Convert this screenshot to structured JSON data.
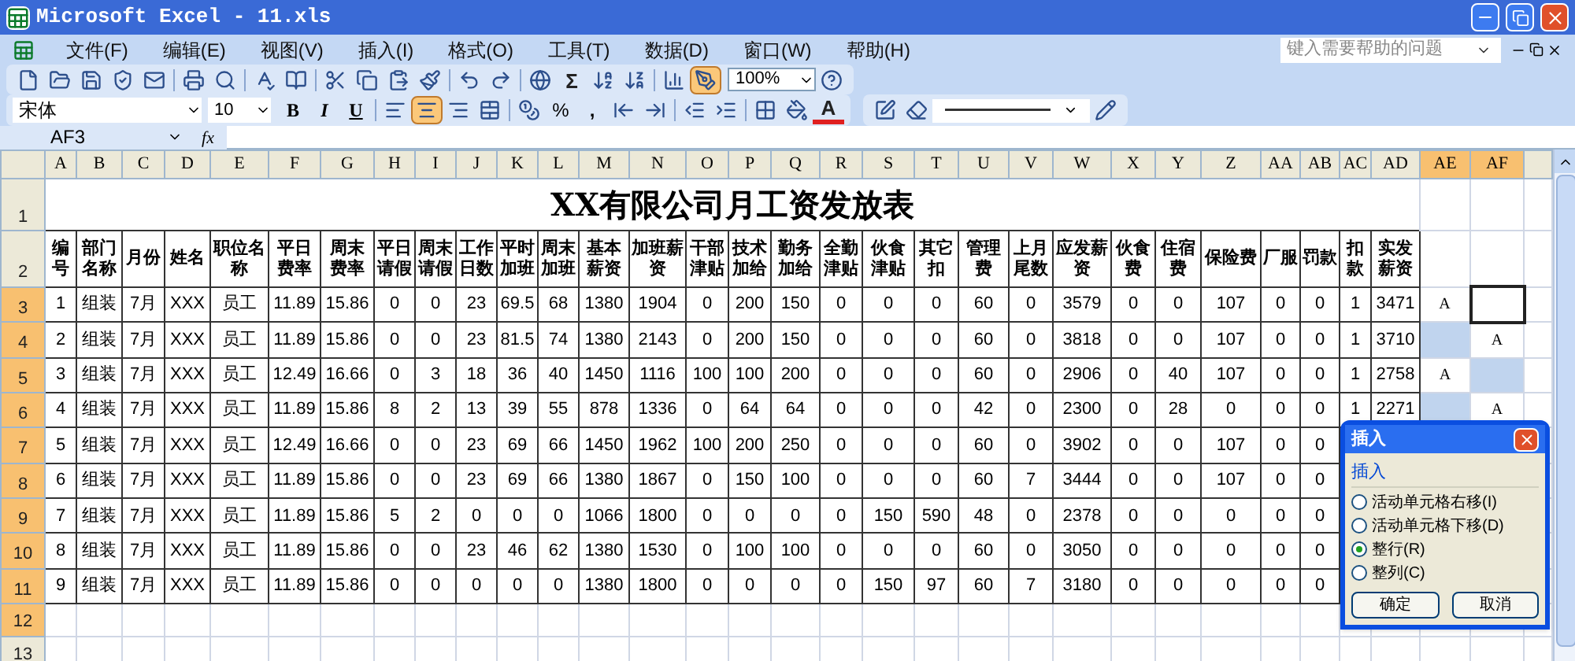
{
  "window": {
    "title": "Microsoft Excel - 11.xls"
  },
  "menu": [
    "文件(F)",
    "编辑(E)",
    "视图(V)",
    "插入(I)",
    "格式(O)",
    "工具(T)",
    "数据(D)",
    "窗口(W)",
    "帮助(H)"
  ],
  "help_box": {
    "placeholder": "键入需要帮助的问题"
  },
  "toolbar": {
    "sum_glyph": "Σ",
    "zoom": "100%",
    "drawing_toggle": {
      "selected": true
    }
  },
  "format_toolbar": {
    "font": "宋体",
    "size": "10",
    "style_buttons": [
      "B",
      "I",
      "U"
    ],
    "align_buttons": [
      {
        "selected": false
      },
      {
        "selected": true
      },
      {
        "selected": false
      }
    ],
    "percent": "%",
    "comma": ",",
    "font_color_glyph": "A"
  },
  "formula_bar": {
    "name_box": "AF3",
    "fx": "fx"
  },
  "sheet": {
    "columns": [
      {
        "label": "A",
        "selected": false
      },
      {
        "label": "B",
        "selected": false
      },
      {
        "label": "C",
        "selected": false
      },
      {
        "label": "D",
        "selected": false
      },
      {
        "label": "E",
        "selected": false
      },
      {
        "label": "F",
        "selected": false
      },
      {
        "label": "G",
        "selected": false
      },
      {
        "label": "H",
        "selected": false
      },
      {
        "label": "I",
        "selected": false
      },
      {
        "label": "J",
        "selected": false
      },
      {
        "label": "K",
        "selected": false
      },
      {
        "label": "L",
        "selected": false
      },
      {
        "label": "M",
        "selected": false
      },
      {
        "label": "N",
        "selected": false
      },
      {
        "label": "O",
        "selected": false
      },
      {
        "label": "P",
        "selected": false
      },
      {
        "label": "Q",
        "selected": false
      },
      {
        "label": "R",
        "selected": false
      },
      {
        "label": "S",
        "selected": false
      },
      {
        "label": "T",
        "selected": false
      },
      {
        "label": "U",
        "selected": false
      },
      {
        "label": "V",
        "selected": false
      },
      {
        "label": "W",
        "selected": false
      },
      {
        "label": "X",
        "selected": false
      },
      {
        "label": "Y",
        "selected": false
      },
      {
        "label": "Z",
        "selected": false
      },
      {
        "label": "AA",
        "selected": false
      },
      {
        "label": "AB",
        "selected": false
      },
      {
        "label": "AC",
        "selected": false
      },
      {
        "label": "AD",
        "selected": false
      },
      {
        "label": "AE",
        "selected": true
      },
      {
        "label": "AF",
        "selected": true
      }
    ],
    "title_row": {
      "row_number": "1",
      "selected": false,
      "title": "XX有限公司月工资发放表"
    },
    "header_row": {
      "row_number": "2",
      "selected": false,
      "headers": [
        "编号",
        "部门名称",
        "月份",
        "姓名",
        "职位名称",
        "平日费率",
        "周末费率",
        "平日请假",
        "周末请假",
        "工作日数",
        "平时加班",
        "周末加班",
        "基本薪资",
        "加班薪资",
        "干部津贴",
        "技术加给",
        "勤务加给",
        "全勤津贴",
        "伙食津贴",
        "其它扣",
        "管理费",
        "上月尾数",
        "应发薪资",
        "伙食费",
        "住宿费",
        "保险费",
        "厂服",
        "罚款",
        "扣款",
        "实发薪资"
      ]
    },
    "rows": [
      {
        "row_number": "3",
        "selected": true,
        "cells": [
          "1",
          "组装",
          "7月",
          "XXX",
          "员工",
          "11.89",
          "15.86",
          "0",
          "0",
          "23",
          "69.5",
          "68",
          "1380",
          "1904",
          "0",
          "200",
          "150",
          "0",
          "0",
          "0",
          "60",
          "0",
          "3579",
          "0",
          "0",
          "107",
          "0",
          "0",
          "1",
          "3471"
        ],
        "extra": [
          {
            "text": "A",
            "selected": false,
            "active": false
          },
          {
            "selected": false,
            "active": true
          }
        ]
      },
      {
        "row_number": "4",
        "selected": true,
        "cells": [
          "2",
          "组装",
          "7月",
          "XXX",
          "员工",
          "11.89",
          "15.86",
          "0",
          "0",
          "23",
          "81.5",
          "74",
          "1380",
          "2143",
          "0",
          "200",
          "150",
          "0",
          "0",
          "0",
          "60",
          "0",
          "3818",
          "0",
          "0",
          "107",
          "0",
          "0",
          "1",
          "3710"
        ],
        "extra": [
          {
            "selected": true,
            "active": false
          },
          {
            "text": "A",
            "selected": false,
            "active": false
          }
        ]
      },
      {
        "row_number": "5",
        "selected": true,
        "cells": [
          "3",
          "组装",
          "7月",
          "XXX",
          "员工",
          "12.49",
          "16.66",
          "0",
          "3",
          "18",
          "36",
          "40",
          "1450",
          "1116",
          "100",
          "100",
          "200",
          "0",
          "0",
          "0",
          "60",
          "0",
          "2906",
          "0",
          "40",
          "107",
          "0",
          "0",
          "1",
          "2758"
        ],
        "extra": [
          {
            "text": "A",
            "selected": false,
            "active": false
          },
          {
            "selected": true,
            "active": false
          }
        ]
      },
      {
        "row_number": "6",
        "selected": true,
        "cells": [
          "4",
          "组装",
          "7月",
          "XXX",
          "员工",
          "11.89",
          "15.86",
          "8",
          "2",
          "13",
          "39",
          "55",
          "878",
          "1336",
          "0",
          "64",
          "64",
          "0",
          "0",
          "0",
          "42",
          "0",
          "2300",
          "0",
          "28",
          "0",
          "0",
          "0",
          "1",
          "2271"
        ],
        "extra": [
          {
            "selected": true,
            "active": false
          },
          {
            "text": "A",
            "selected": false,
            "active": false
          }
        ]
      },
      {
        "row_number": "7",
        "selected": true,
        "cells": [
          "5",
          "组装",
          "7月",
          "XXX",
          "员工",
          "12.49",
          "16.66",
          "0",
          "0",
          "23",
          "69",
          "66",
          "1450",
          "1962",
          "100",
          "200",
          "250",
          "0",
          "0",
          "0",
          "60",
          "0",
          "3902",
          "0",
          "0",
          "107",
          "0",
          "0"
        ]
      },
      {
        "row_number": "8",
        "selected": true,
        "cells": [
          "6",
          "组装",
          "7月",
          "XXX",
          "员工",
          "11.89",
          "15.86",
          "0",
          "0",
          "23",
          "69",
          "66",
          "1380",
          "1867",
          "0",
          "150",
          "100",
          "0",
          "0",
          "0",
          "60",
          "7",
          "3444",
          "0",
          "0",
          "107",
          "0",
          "0"
        ]
      },
      {
        "row_number": "9",
        "selected": true,
        "cells": [
          "7",
          "组装",
          "7月",
          "XXX",
          "员工",
          "11.89",
          "15.86",
          "5",
          "2",
          "0",
          "0",
          "0",
          "1066",
          "1800",
          "0",
          "0",
          "0",
          "0",
          "150",
          "590",
          "48",
          "0",
          "2378",
          "0",
          "0",
          "0",
          "0",
          "0"
        ]
      },
      {
        "row_number": "10",
        "selected": true,
        "cells": [
          "8",
          "组装",
          "7月",
          "XXX",
          "员工",
          "11.89",
          "15.86",
          "0",
          "0",
          "23",
          "46",
          "62",
          "1380",
          "1530",
          "0",
          "100",
          "100",
          "0",
          "0",
          "0",
          "60",
          "0",
          "3050",
          "0",
          "0",
          "0",
          "0",
          "0"
        ]
      },
      {
        "row_number": "11",
        "selected": true,
        "cells": [
          "9",
          "组装",
          "7月",
          "XXX",
          "员工",
          "11.89",
          "15.86",
          "0",
          "0",
          "0",
          "0",
          "0",
          "1380",
          "1800",
          "0",
          "0",
          "0",
          "0",
          "150",
          "97",
          "60",
          "7",
          "3180",
          "0",
          "0",
          "0",
          "0",
          "0"
        ]
      }
    ],
    "empty_rows": [
      {
        "row_number": "12",
        "selected": true
      },
      {
        "row_number": "13",
        "selected": false
      }
    ]
  },
  "dialog": {
    "title": "插入",
    "group": "插入",
    "options": [
      {
        "label": "活动单元格右移(I)",
        "selected": false
      },
      {
        "label": "活动单元格下移(D)",
        "selected": false
      },
      {
        "label": "整行(R)",
        "selected": true
      },
      {
        "label": "整列(C)",
        "selected": false
      }
    ],
    "buttons": [
      "确定",
      "取消"
    ]
  }
}
